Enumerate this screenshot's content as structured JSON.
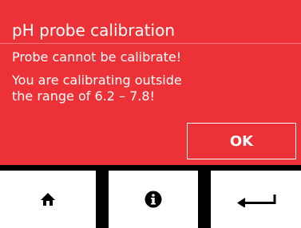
{
  "dialog": {
    "title": "pH probe calibration",
    "message_line1": "Probe cannot be calibrate!",
    "message_line2": "You are calibrating outside",
    "message_line3": "the range of 6.2 – 7.8!",
    "ok_label": "OK",
    "background_color": "#ec3137"
  },
  "nav": {
    "buttons": [
      {
        "icon": "home-icon"
      },
      {
        "icon": "info-icon"
      },
      {
        "icon": "back-arrow-icon"
      }
    ]
  }
}
